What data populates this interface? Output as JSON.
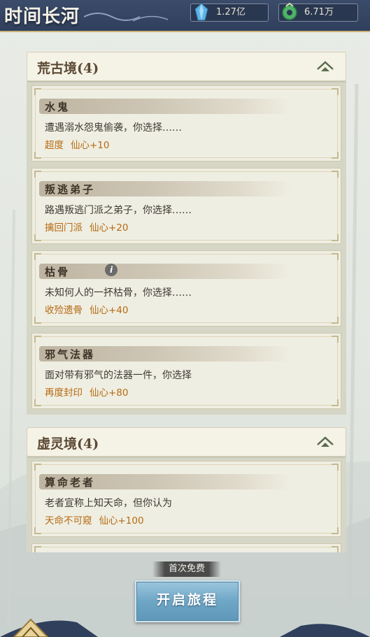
{
  "header": {
    "title": "时间长河",
    "resources": [
      {
        "icon": "blue-crystal-icon",
        "value": "1.27亿"
      },
      {
        "icon": "green-jade-icon",
        "value": "6.71万"
      }
    ]
  },
  "sections": [
    {
      "title": "荒古境(4)",
      "toggle_icon": "collapse-arrow-icon",
      "events": [
        {
          "name": "水鬼",
          "description": "遭遇溺水怨鬼偷袭，你选择……",
          "option": "超度",
          "reward": "仙心+10"
        },
        {
          "name": "叛逃弟子",
          "description": "路遇叛逃门派之弟子，你选择……",
          "option": "擒回门派",
          "reward": "仙心+20"
        },
        {
          "name": "枯骨",
          "description": "未知何人的一抔枯骨，你选择……",
          "option": "收殓遗骨",
          "reward": "仙心+40",
          "info_icon": "i"
        },
        {
          "name": "邪气法器",
          "description": "面对带有邪气的法器一件，你选择",
          "option": "再度封印",
          "reward": "仙心+80"
        }
      ]
    },
    {
      "title": "虚灵境(4)",
      "toggle_icon": "collapse-arrow-icon",
      "events": [
        {
          "name": "算命老者",
          "description": "老者宣称上知天命，但你认为",
          "option": "天命不可窥",
          "reward": "仙心+100"
        }
      ]
    }
  ],
  "footer": {
    "free_tag": "首次免费",
    "start_button": "开启旅程"
  },
  "colors": {
    "header_bg": "#2f3f5c",
    "option_text": "#b56a12",
    "button_blue": "#6ea6c6"
  }
}
